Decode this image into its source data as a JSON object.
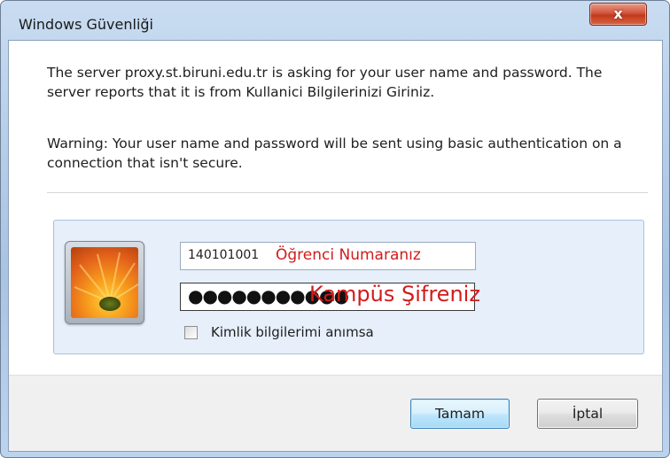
{
  "window": {
    "title": "Windows Güvenliği",
    "close_label": "x"
  },
  "message": {
    "line1": "The server proxy.st.biruni.edu.tr is asking for your user name and password. The server reports that it is from Kullanici Bilgilerinizi Giriniz.",
    "line2": "Warning: Your user name and password will be sent using basic authentication on a connection that isn't secure."
  },
  "credentials": {
    "avatar_icon": "user-flower-picture",
    "username_value": "140101001",
    "username_hint": "Öğrenci Numaranız",
    "password_mask": "●●●●●●●●●●●",
    "password_hint": "Kampüs Şifreniz",
    "remember_label": "Kimlik bilgilerimi anımsa",
    "remember_checked": false
  },
  "buttons": {
    "ok_label": "Tamam",
    "cancel_label": "İptal"
  },
  "colors": {
    "hint_text": "#d21c1c",
    "title_bar": "#b7cee9",
    "panel_bg": "#e6effa"
  }
}
